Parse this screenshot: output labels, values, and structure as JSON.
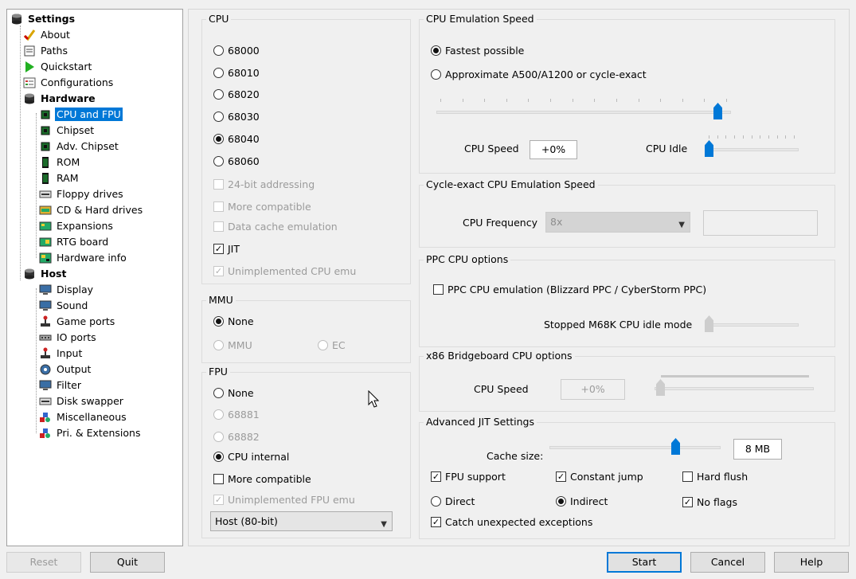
{
  "tree": {
    "settings": "Settings",
    "about": "About",
    "paths": "Paths",
    "quickstart": "Quickstart",
    "configurations": "Configurations",
    "hardware": "Hardware",
    "cpu_fpu": "CPU and FPU",
    "chipset": "Chipset",
    "adv_chipset": "Adv. Chipset",
    "rom": "ROM",
    "ram": "RAM",
    "floppy": "Floppy drives",
    "cd_hard": "CD & Hard drives",
    "expansions": "Expansions",
    "rtg": "RTG board",
    "hwinfo": "Hardware info",
    "host": "Host",
    "display": "Display",
    "sound": "Sound",
    "gameports": "Game ports",
    "ioports": "IO ports",
    "input": "Input",
    "output": "Output",
    "filter": "Filter",
    "diskswapper": "Disk swapper",
    "misc": "Miscellaneous",
    "pri": "Pri. & Extensions"
  },
  "cpu": {
    "title": "CPU",
    "options": [
      "68000",
      "68010",
      "68020",
      "68030",
      "68040",
      "68060"
    ],
    "selected": "68040",
    "addr24": "24-bit addressing",
    "more_compatible": "More compatible",
    "data_cache": "Data cache emulation",
    "jit": "JIT",
    "unimpl": "Unimplemented CPU emu"
  },
  "mmu": {
    "title": "MMU",
    "none": "None",
    "mmu": "MMU",
    "ec": "EC"
  },
  "fpu": {
    "title": "FPU",
    "none": "None",
    "f68881": "68881",
    "f68882": "68882",
    "internal": "CPU internal",
    "more_compatible": "More compatible",
    "unimpl": "Unimplemented FPU emu",
    "precision": "Host (80-bit)"
  },
  "speed": {
    "title": "CPU Emulation Speed",
    "fastest": "Fastest possible",
    "approx": "Approximate A500/A1200 or cycle-exact",
    "slider_level": 0.97,
    "cpu_speed_label": "CPU Speed",
    "cpu_speed_value": "+0%",
    "cpu_idle_label": "CPU Idle",
    "cpu_idle_level": 0.0
  },
  "cycle": {
    "title": "Cycle-exact CPU Emulation Speed",
    "freq_label": "CPU Frequency",
    "freq_value": "8x"
  },
  "ppc": {
    "title": "PPC CPU options",
    "emulation": "PPC CPU emulation (Blizzard PPC / CyberStorm PPC)",
    "idle_label": "Stopped M68K CPU idle mode"
  },
  "x86": {
    "title": "x86 Bridgeboard CPU options",
    "speed_label": "CPU Speed",
    "speed_value": "+0%"
  },
  "jit": {
    "title": "Advanced JIT Settings",
    "cache_label": "Cache size:",
    "cache_value": "8 MB",
    "cache_level": 0.75,
    "fpu_support": "FPU support",
    "constant_jump": "Constant jump",
    "hard_flush": "Hard flush",
    "direct": "Direct",
    "indirect": "Indirect",
    "no_flags": "No flags",
    "catch": "Catch unexpected exceptions"
  },
  "buttons": {
    "reset": "Reset",
    "quit": "Quit",
    "start": "Start",
    "cancel": "Cancel",
    "help": "Help"
  },
  "colors": {
    "accent": "#0078d7",
    "background": "#f0f0f0"
  }
}
